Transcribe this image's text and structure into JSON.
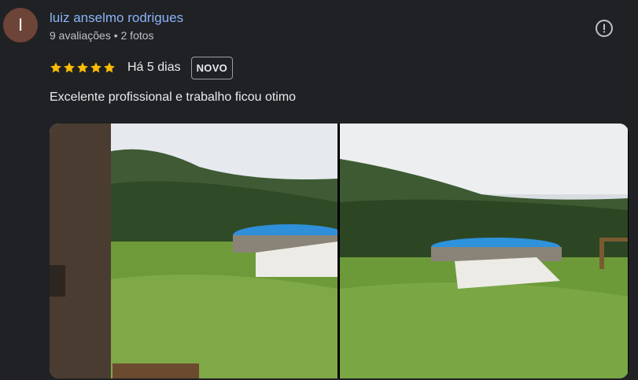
{
  "review": {
    "author": {
      "initial": "I",
      "name": "luiz anselmo rodrigues",
      "meta": "9 avaliações • 2 fotos"
    },
    "rating": 5,
    "max_rating": 5,
    "date": "Há 5 dias",
    "badge": "NOVO",
    "text": "Excelente profissional e trabalho ficou otimo",
    "photos": [
      {
        "icon": "photo-garden-pool"
      },
      {
        "icon": "photo-garden-pool"
      }
    ]
  },
  "colors": {
    "background": "#202124",
    "link": "#8ab4f8",
    "star": "#fbbc04",
    "avatar": "#6d4438"
  },
  "icons": {
    "more": "exclamation-circle-icon"
  }
}
